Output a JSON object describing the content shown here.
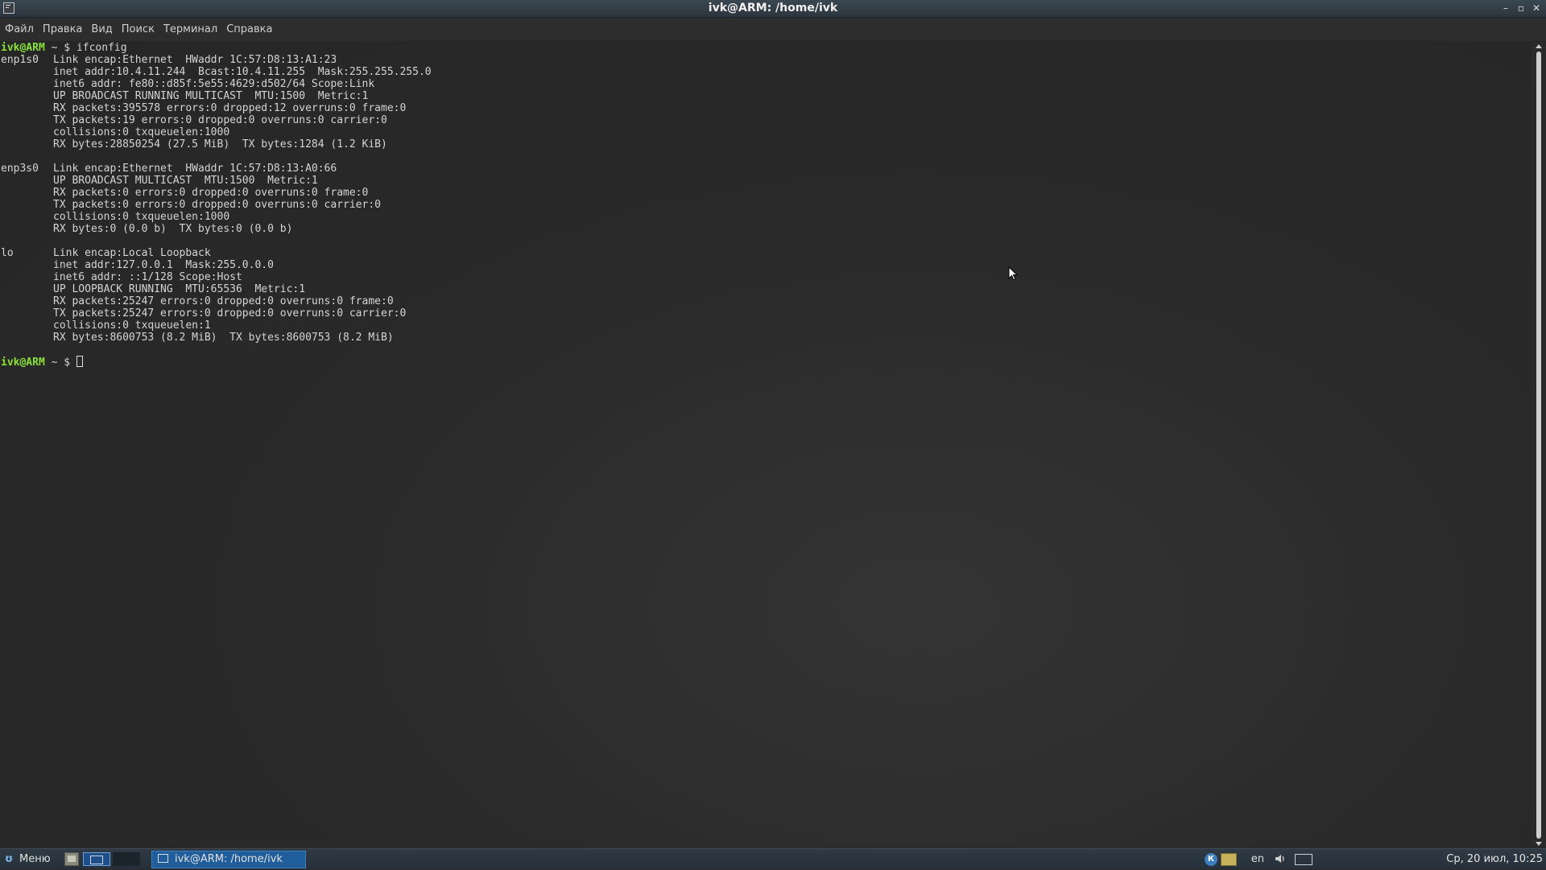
{
  "window": {
    "title": "ivk@ARM: /home/ivk",
    "minimize_glyph": "–",
    "maximize_glyph": "▫",
    "close_glyph": "✕"
  },
  "menu": [
    "Файл",
    "Правка",
    "Вид",
    "Поиск",
    "Терминал",
    "Справка"
  ],
  "terminal": {
    "prompt_user": "ivk@ARM",
    "prompt_path": " ~ $ ",
    "command": "ifconfig",
    "blocks": [
      {
        "iface": "enp1s0",
        "lines": [
          "Link encap:Ethernet  HWaddr 1C:57:D8:13:A1:23",
          "inet addr:10.4.11.244  Bcast:10.4.11.255  Mask:255.255.255.0",
          "inet6 addr: fe80::d85f:5e55:4629:d502/64 Scope:Link",
          "UP BROADCAST RUNNING MULTICAST  MTU:1500  Metric:1",
          "RX packets:395578 errors:0 dropped:12 overruns:0 frame:0",
          "TX packets:19 errors:0 dropped:0 overruns:0 carrier:0",
          "collisions:0 txqueuelen:1000",
          "RX bytes:28850254 (27.5 MiB)  TX bytes:1284 (1.2 KiB)"
        ]
      },
      {
        "iface": "enp3s0",
        "lines": [
          "Link encap:Ethernet  HWaddr 1C:57:D8:13:A0:66",
          "UP BROADCAST MULTICAST  MTU:1500  Metric:1",
          "RX packets:0 errors:0 dropped:0 overruns:0 frame:0",
          "TX packets:0 errors:0 dropped:0 overruns:0 carrier:0",
          "collisions:0 txqueuelen:1000",
          "RX bytes:0 (0.0 b)  TX bytes:0 (0.0 b)"
        ]
      },
      {
        "iface": "lo",
        "lines": [
          "Link encap:Local Loopback",
          "inet addr:127.0.0.1  Mask:255.0.0.0",
          "inet6 addr: ::1/128 Scope:Host",
          "UP LOOPBACK RUNNING  MTU:65536  Metric:1",
          "RX packets:25247 errors:0 dropped:0 overruns:0 frame:0",
          "TX packets:25247 errors:0 dropped:0 overruns:0 carrier:0",
          "collisions:0 txqueuelen:1",
          "RX bytes:8600753 (8.2 MiB)  TX bytes:8600753 (8.2 MiB)"
        ]
      }
    ]
  },
  "taskbar": {
    "start_label": "Меню",
    "task_title": "ivk@ARM: /home/ivk",
    "keyboard_indicator": "К",
    "language": "en",
    "clock": "Ср, 20 июл, 10:25",
    "icons": {
      "start": "menu-icon",
      "files": "file-manager-icon",
      "terminal": "terminal-icon",
      "volume": "volume-icon",
      "network": "network-icon"
    }
  },
  "colors": {
    "prompt_user": "#8ae234",
    "terminal_text": "#d4d4d4",
    "task_active": "#1f5d9b"
  }
}
